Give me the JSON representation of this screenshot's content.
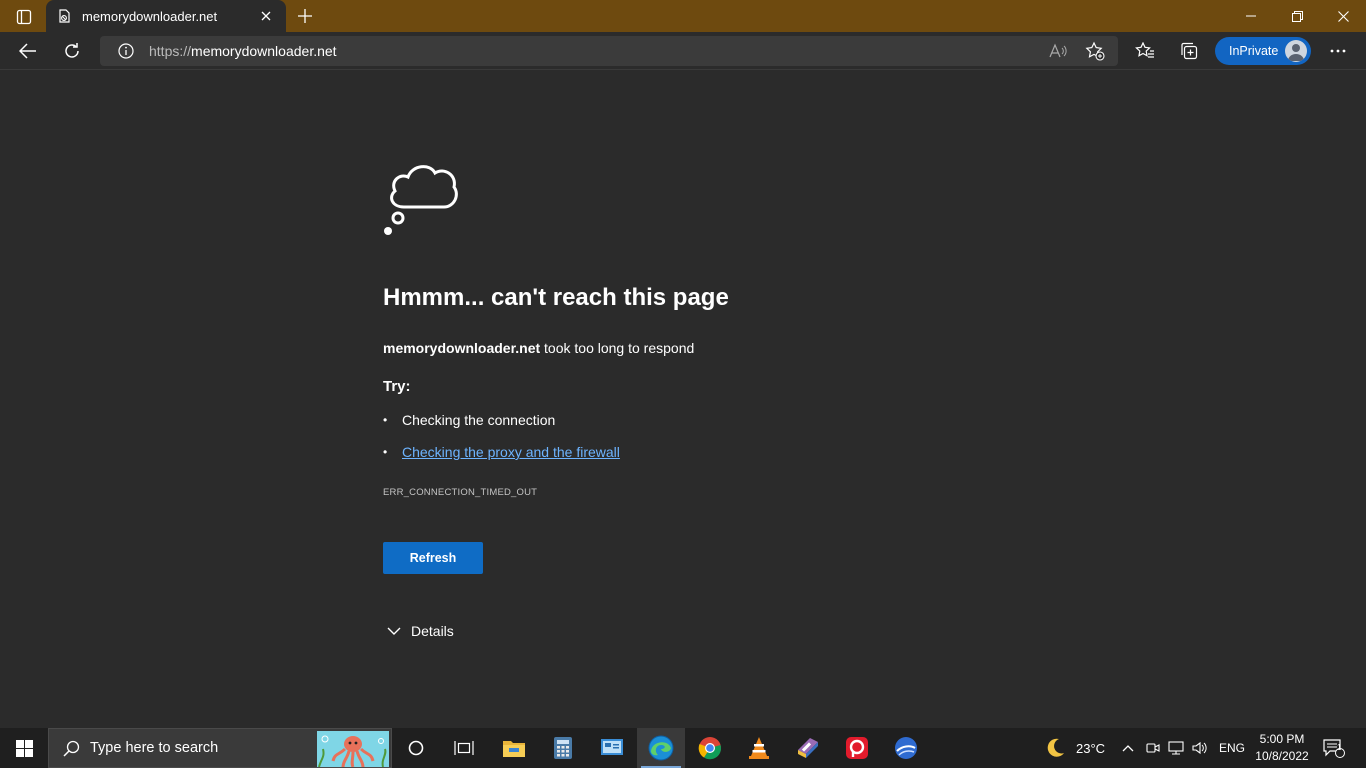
{
  "browser": {
    "tab": {
      "title": "memorydownloader.net"
    },
    "address": {
      "scheme": "https://",
      "host": "memorydownloader.net"
    },
    "inprivate_label": "InPrivate"
  },
  "page": {
    "heading": "Hmmm... can't reach this page",
    "host_bold": "memorydownloader.net",
    "message": " took too long to respond",
    "try_label": "Try:",
    "suggestions": [
      {
        "text": "Checking the connection",
        "link": false
      },
      {
        "text": "Checking the proxy and the firewall",
        "link": true
      }
    ],
    "error_code": "ERR_CONNECTION_TIMED_OUT",
    "refresh_label": "Refresh",
    "details_label": "Details"
  },
  "taskbar": {
    "search_placeholder": "Type here to search",
    "weather": "23°C",
    "language": "ENG",
    "time": "5:00 PM",
    "date": "10/8/2022",
    "notification_count": "1",
    "pinned": [
      "cortana-icon",
      "task-view-icon",
      "file-explorer-icon",
      "calculator-icon",
      "control-panel-icon",
      "edge-icon",
      "chrome-icon",
      "vlc-icon",
      "winrar-icon",
      "screen-recorder-icon",
      "earth-icon"
    ]
  },
  "colors": {
    "tabstrip": "#6e4a0f",
    "background": "#2b2b2b",
    "accent": "#0f6cc5",
    "link": "#6db4ff"
  }
}
